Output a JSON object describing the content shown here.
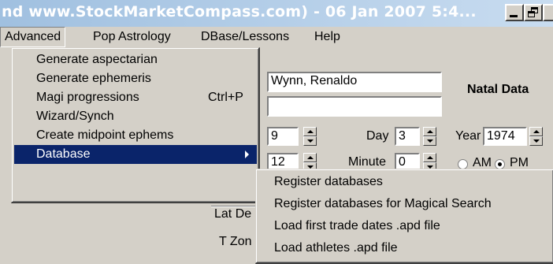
{
  "window": {
    "title": "nd www.StockMarketCompass.com) - 06 Jan 2007    5:4...",
    "controls": [
      "minimize-icon",
      "maximize-icon",
      "close-icon"
    ]
  },
  "menubar": {
    "items": [
      {
        "label": "Advanced",
        "active": true
      },
      {
        "label": "Pop Astrology"
      },
      {
        "label": "DBase/Lessons"
      },
      {
        "label": "Help"
      }
    ]
  },
  "advanced_menu": {
    "items": [
      {
        "label": "Generate aspectarian"
      },
      {
        "label": "Generate ephemeris"
      },
      {
        "label": "Magi progressions",
        "shortcut": "Ctrl+P"
      },
      {
        "label": "Wizard/Synch"
      },
      {
        "label": "Create midpoint ephems"
      },
      {
        "label": "Database",
        "has_submenu": true,
        "selected": true
      }
    ]
  },
  "database_submenu": {
    "items": [
      {
        "label": "Register databases"
      },
      {
        "label": "Register databases for Magical Search"
      },
      {
        "label": "Load first trade dates .apd file"
      },
      {
        "label": "Load athletes .apd file"
      }
    ]
  },
  "form": {
    "name_value": "Wynn, Renaldo",
    "second_value": "",
    "natal_data_label": "Natal Data",
    "month_value": "9",
    "day_label": "Day",
    "day_value": "3",
    "year_label": "Year",
    "year_value": "1974",
    "hour_value": "12",
    "minute_label": "Minute",
    "minute_value": "0",
    "am_label": "AM",
    "pm_label": "PM",
    "am_selected": false,
    "pm_selected": true,
    "lat_label": "Lat De",
    "tzone_label": "T Zon"
  },
  "colors": {
    "title_gradient_start": "#a0c0e0",
    "title_gradient_end": "#c8dcf0",
    "menu_highlight": "#0a246a",
    "face": "#d4d0c8"
  }
}
